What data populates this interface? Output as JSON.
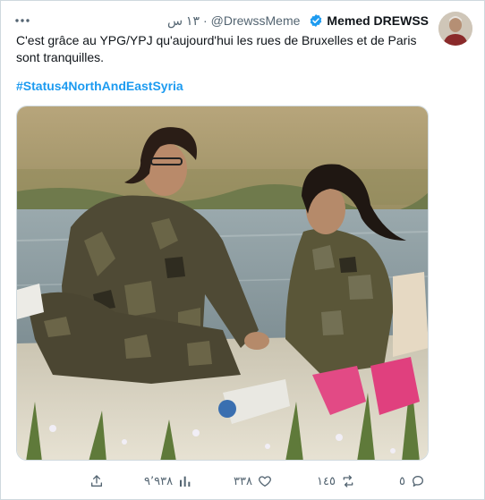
{
  "tweet": {
    "display_name": "Memed DREWSS",
    "handle": "@DrewssMeme",
    "time": "١٣ س",
    "text": "C'est grâce au YPG/YPJ qu'aujourd'hui les rues de Bruxelles et de Paris sont tranquilles.",
    "hashtag": "#Status4NorthAndEastSyria"
  },
  "actions": {
    "replies": "٥",
    "retweets": "١٤٥",
    "likes": "٣٣٨",
    "views": "٩٬٩٣٨"
  },
  "icons": {
    "more": "more-icon",
    "verified": "verified-badge-icon",
    "reply": "reply-icon",
    "retweet": "retweet-icon",
    "like": "like-icon",
    "views": "views-icon",
    "share": "share-icon"
  },
  "colors": {
    "accent": "#1d9bf0",
    "secondary_text": "#536471",
    "border": "#cfd9de"
  }
}
